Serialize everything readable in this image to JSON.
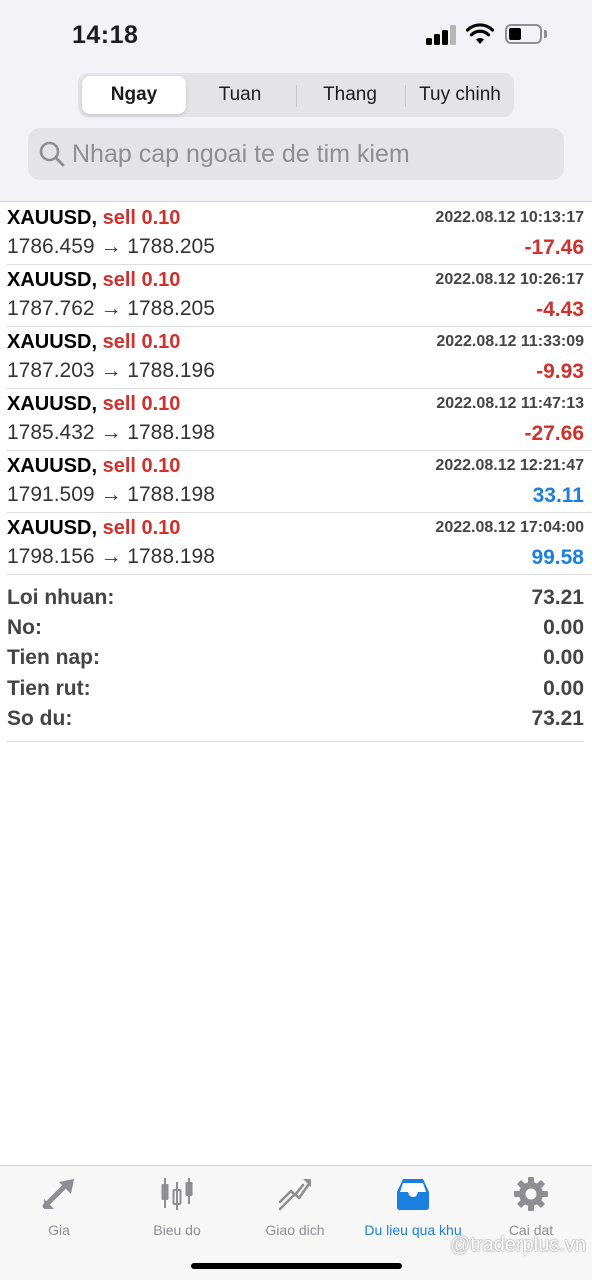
{
  "status_bar": {
    "time": "14:18"
  },
  "tabs_segment": [
    {
      "label": "Ngay",
      "active": true
    },
    {
      "label": "Tuan",
      "active": false
    },
    {
      "label": "Thang",
      "active": false
    },
    {
      "label": "Tuy chinh",
      "active": false
    }
  ],
  "search": {
    "placeholder": "Nhap cap ngoai te de tim kiem",
    "value": ""
  },
  "deals": [
    {
      "symbol": "XAUUSD,",
      "type": "sell 0.10",
      "time": "2022.08.12 10:13:17",
      "open": "1786.459",
      "arrow": "→",
      "close": "1788.205",
      "profit": "-17.46"
    },
    {
      "symbol": "XAUUSD,",
      "type": "sell 0.10",
      "time": "2022.08.12 10:26:17",
      "open": "1787.762",
      "arrow": "→",
      "close": "1788.205",
      "profit": "-4.43"
    },
    {
      "symbol": "XAUUSD,",
      "type": "sell 0.10",
      "time": "2022.08.12 11:33:09",
      "open": "1787.203",
      "arrow": "→",
      "close": "1788.196",
      "profit": "-9.93"
    },
    {
      "symbol": "XAUUSD,",
      "type": "sell 0.10",
      "time": "2022.08.12 11:47:13",
      "open": "1785.432",
      "arrow": "→",
      "close": "1788.198",
      "profit": "-27.66"
    },
    {
      "symbol": "XAUUSD,",
      "type": "sell 0.10",
      "time": "2022.08.12 12:21:47",
      "open": "1791.509",
      "arrow": "→",
      "close": "1788.198",
      "profit": "33.11"
    },
    {
      "symbol": "XAUUSD,",
      "type": "sell 0.10",
      "time": "2022.08.12 17:04:00",
      "open": "1798.156",
      "arrow": "→",
      "close": "1788.198",
      "profit": "99.58"
    }
  ],
  "summary": {
    "profit": {
      "label": "Loi nhuan:",
      "value": "73.21"
    },
    "credit": {
      "label": "No:",
      "value": "0.00"
    },
    "deposit": {
      "label": "Tien nap:",
      "value": "0.00"
    },
    "withdrawal": {
      "label": "Tien rut:",
      "value": "0.00"
    },
    "balance": {
      "label": "So du:",
      "value": "73.21"
    }
  },
  "tabbar": [
    {
      "label": "Gia",
      "icon": "quotes-arrows-icon",
      "active": false
    },
    {
      "label": "Bieu do",
      "icon": "candlestick-chart-icon",
      "active": false
    },
    {
      "label": "Giao dich",
      "icon": "trade-trend-icon",
      "active": false
    },
    {
      "label": "Du lieu qua khu",
      "icon": "history-inbox-icon",
      "active": true
    },
    {
      "label": "Cai dat",
      "icon": "gear-icon",
      "active": false
    }
  ],
  "watermark": "@traderplus.vn",
  "colors": {
    "negative": "#d0312d",
    "positive": "#1a7fe0",
    "sell": "#d0312d",
    "active_tab": "#1a7fe0"
  }
}
